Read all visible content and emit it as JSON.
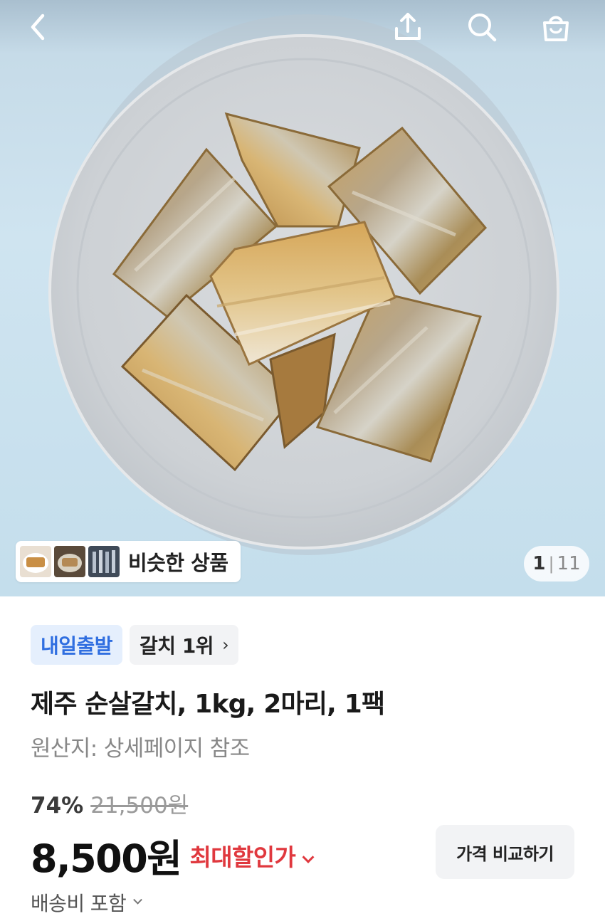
{
  "header": {
    "back_icon": "chevron-left-icon",
    "share_icon": "share-icon",
    "search_icon": "search-icon",
    "cart_icon": "shopping-bag-icon"
  },
  "gallery": {
    "similar_label": "비슷한 상품",
    "current": "1",
    "separator": "|",
    "total": "11"
  },
  "product": {
    "tag_delivery": "내일출발",
    "tag_rank": "갈치 1위",
    "title": "제주 순살갈치, 1kg, 2마리, 1팩",
    "origin": "원산지: 상세페이지 참조"
  },
  "pricing": {
    "discount_rate": "74%",
    "original_price": "21,500원",
    "price": "8,500원",
    "max_discount_label": "최대할인가",
    "compare_label": "가격 비교하기",
    "shipping_label": "배송비 포함"
  },
  "colors": {
    "discount_red": "#e0383e",
    "tag_blue": "#2f6ee0",
    "tag_blue_bg": "#e5effd",
    "background_blue": "#cfe4f0"
  }
}
